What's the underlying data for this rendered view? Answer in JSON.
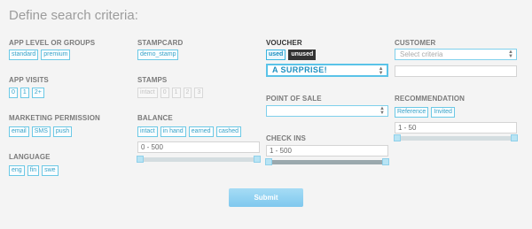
{
  "title": "Define search criteria:",
  "app_level": {
    "label": "APP LEVEL OR GROUPS",
    "tags": [
      "standard",
      "premium"
    ]
  },
  "app_visits": {
    "label": "APP VISITS",
    "tags": [
      "0",
      "1",
      "2+"
    ]
  },
  "marketing": {
    "label": "MARKETING PERMISSION",
    "tags": [
      "email",
      "SMS",
      "push"
    ]
  },
  "language": {
    "label": "LANGUAGE",
    "tags": [
      "eng",
      "fin",
      "swe"
    ]
  },
  "stampcard": {
    "label": "STAMPCARD",
    "tags": [
      "demo_stamp"
    ]
  },
  "stamps": {
    "label": "STAMPS",
    "tags": [
      "intact",
      "0",
      "1",
      "2",
      "3"
    ]
  },
  "balance": {
    "label": "BALANCE",
    "tags": [
      "intact",
      "in hand",
      "earned",
      "cashed"
    ],
    "range": "0 - 500"
  },
  "voucher": {
    "label": "VOUCHER",
    "tags": [
      "used",
      "unused"
    ],
    "selected": "A SURPRISE!"
  },
  "point_of_sale": {
    "label": "POINT OF SALE",
    "selected": ""
  },
  "check_ins": {
    "label": "CHECK INS",
    "range": "1 - 500"
  },
  "customer": {
    "label": "CUSTOMER",
    "placeholder": "Select criteria",
    "input_value": ""
  },
  "recommendation": {
    "label": "RECOMMENDATION",
    "tags": [
      "Reference",
      "Invited"
    ],
    "range": "1 - 50"
  },
  "submit_label": "Submit"
}
